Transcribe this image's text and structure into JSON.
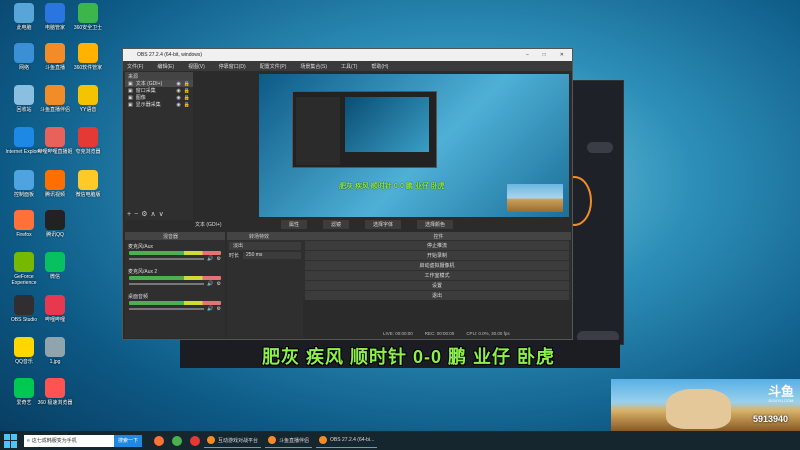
{
  "desktop": {
    "icons": [
      {
        "label": "此电脑",
        "color": "#58a6d8"
      },
      {
        "label": "电脑管家",
        "color": "#2a75e0"
      },
      {
        "label": "360安全卫士",
        "color": "#3cb54a"
      },
      {
        "label": "网络",
        "color": "#3b8fd4"
      },
      {
        "label": "斗鱼直播",
        "color": "#f28c28"
      },
      {
        "label": "360软件管家",
        "color": "#ffb300"
      },
      {
        "label": "回收站",
        "color": "#8bbfe0"
      },
      {
        "label": "斗鱼直播伴侣",
        "color": "#f28c28"
      },
      {
        "label": "YY语音",
        "color": "#f5c400"
      },
      {
        "label": "Internet Explorer",
        "color": "#1e88e5"
      },
      {
        "label": "哔哩哔哩直播姬",
        "color": "#e8615a"
      },
      {
        "label": "夸克浏览器 ",
        "color": "#e53935"
      },
      {
        "label": "控制面板",
        "color": "#4fa3e0"
      },
      {
        "label": "腾讯视频",
        "color": "#ff6f00"
      },
      {
        "label": "微信电脑版",
        "color": "#ffca28"
      },
      {
        "label": "Firefox",
        "color": "#ff7139"
      },
      {
        "label": "腾讯QQ",
        "color": "#222"
      },
      {
        "label": "GeForce Experience",
        "color": "#76b900"
      },
      {
        "label": "微信",
        "color": "#07c160"
      },
      {
        "label": "OBS Studio",
        "color": "#302e31"
      },
      {
        "label": "哔哩哔哩",
        "color": "#e8384f"
      },
      {
        "label": "QQ音乐",
        "color": "#ffd600"
      },
      {
        "label": "1.jpg",
        "color": "#90a4ae"
      },
      {
        "label": "爱奇艺",
        "color": "#00c853"
      },
      {
        "label": "360 极速浏览器",
        "color": "#ff5252"
      }
    ]
  },
  "obs": {
    "title": "OBS 27.2.4 (64-bit, windows)",
    "menu": [
      "文件(F)",
      "编辑(E)",
      "视图(V)",
      "停靠窗口(D)",
      "配置文件(P)",
      "场景集合(S)",
      "工具(T)",
      "帮助(H)"
    ],
    "sources_header": "来源",
    "sources": [
      "文本 (GDI+)",
      "窗口采集",
      "图像",
      "显示器采集"
    ],
    "text_source_label": "文本 (GDI+)",
    "property_buttons": [
      "属性",
      "滤镜",
      "选择字体",
      "选择颜色"
    ],
    "preview_caption": "肥灰 疾风 顺时针 0-0 鹏 业仔 卧虎",
    "scene_tabs": [
      "场景",
      "来源"
    ],
    "mixer_header": "混音器",
    "transitions_header": "转场特效",
    "controls_header": "控件",
    "audio": [
      {
        "name": "麦克风/Aux"
      },
      {
        "name": "麦克风/Aux 2"
      },
      {
        "name": "桌面音频"
      }
    ],
    "transition": {
      "value": "淡出",
      "duration_label": "时长",
      "duration_value": "250 ms"
    },
    "controls": [
      "停止推流",
      "开始录制",
      "启动虚拟摄像机",
      "工作室模式",
      "设置",
      "退出"
    ],
    "status": [
      "LIVE: 00:00:00",
      "REC: 00:00:00",
      "CPU: 0.0%, 30.00 fps"
    ]
  },
  "overlay_text": "肥灰 疾风 顺时针 0-0 鹏 业仔 卧虎",
  "douyu": {
    "brand": "斗鱼",
    "domain": "DOUYU.COM",
    "room_id": "5913940"
  },
  "taskbar": {
    "search_text": "这七成韩服变为手机",
    "search_button": "搜索一下",
    "items": [
      "互动游戏对战平台",
      "斗鱼直播伴侣",
      "OBS 27.2.4 (64-bi..."
    ]
  }
}
